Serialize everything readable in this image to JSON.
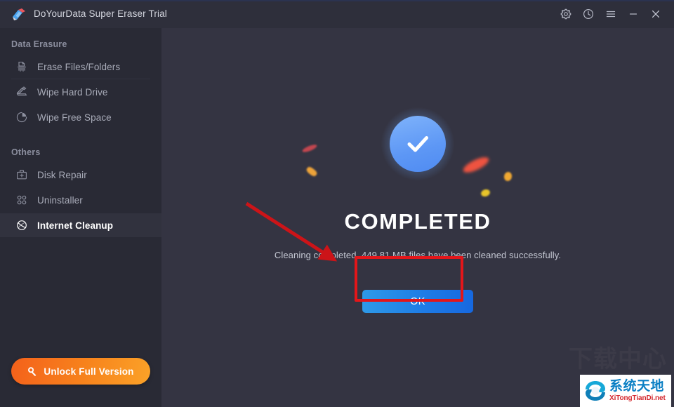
{
  "window": {
    "title": "DoYourData Super Eraser Trial",
    "logo_icon": "eraser-logo-icon",
    "controls": [
      {
        "name": "settings-button",
        "icon": "gear-icon"
      },
      {
        "name": "history-button",
        "icon": "clock-icon"
      },
      {
        "name": "menu-button",
        "icon": "hamburger-menu-icon"
      },
      {
        "name": "minimize-button",
        "icon": "minimize-icon"
      },
      {
        "name": "close-button",
        "icon": "close-icon"
      }
    ]
  },
  "sidebar": {
    "groups": [
      {
        "title": "Data Erasure",
        "items": [
          {
            "label": "Erase Files/Folders",
            "icon": "shredder-icon",
            "active": false
          },
          {
            "label": "Wipe Hard Drive",
            "icon": "wipe-drive-icon",
            "active": false
          },
          {
            "label": "Wipe Free Space",
            "icon": "pie-chart-icon",
            "active": false
          }
        ]
      },
      {
        "title": "Others",
        "items": [
          {
            "label": "Disk Repair",
            "icon": "first-aid-kit-icon",
            "active": false
          },
          {
            "label": "Uninstaller",
            "icon": "grid-dots-icon",
            "active": false
          },
          {
            "label": "Internet Cleanup",
            "icon": "globe-icon",
            "active": true
          }
        ]
      }
    ],
    "unlock_button": {
      "label": "Unlock Full Version",
      "icon": "key-icon"
    }
  },
  "main": {
    "status_icon": "checkmark-circle-icon",
    "title": "COMPLETED",
    "description": "Cleaning completed. 449.81 MB files have been cleaned successfully.",
    "ok_button_label": "OK"
  },
  "annotations": {
    "highlight_box": "red-rectangle-around-ok-button",
    "arrow": "red-arrow-pointing-to-ok-button",
    "color": "#e3161a"
  },
  "watermark": {
    "big_text": "下载中心",
    "logo_cn": "系统天地",
    "logo_en": "XiTongTianDi.net"
  },
  "colors": {
    "window_bg": "#343442",
    "sidebar_bg": "#292a35",
    "titlebar_bg": "#2e2f3b",
    "accent_blue": "#1e7ce6",
    "accent_orange": "#f7821c",
    "annotation_red": "#e3161a",
    "active_item_bg": "#31323e"
  }
}
